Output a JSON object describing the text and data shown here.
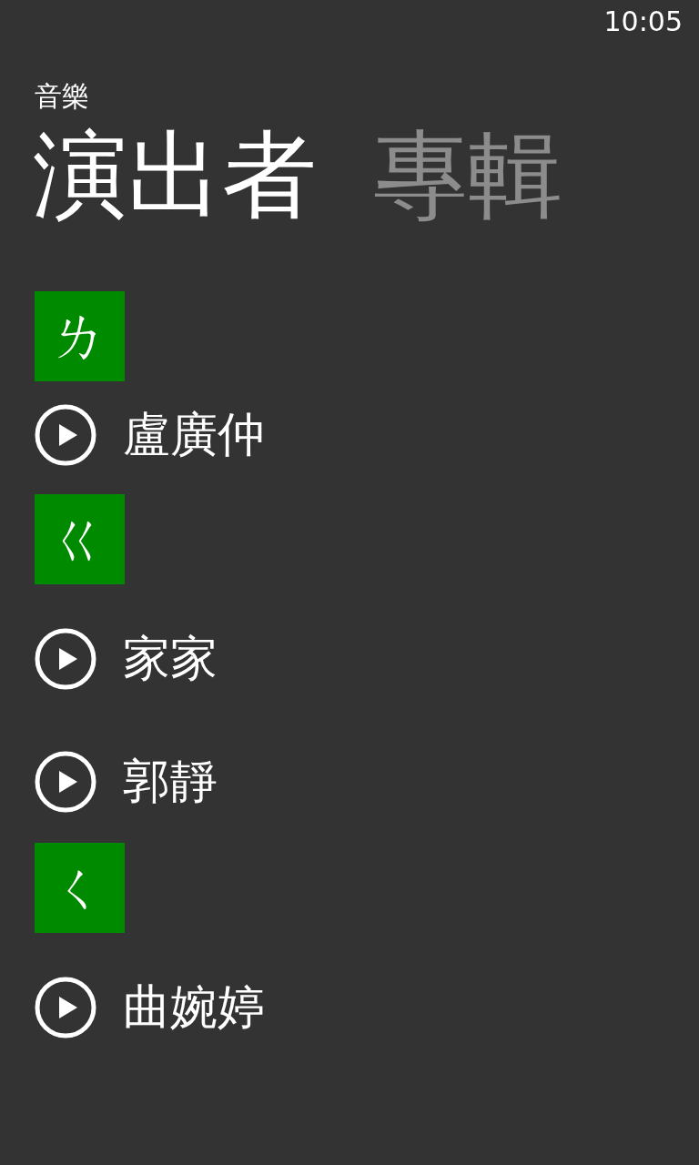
{
  "status_bar": {
    "time": "10:05"
  },
  "app_title": "音樂",
  "pivot": [
    {
      "label": "演出者",
      "selected": true
    },
    {
      "label": "專輯",
      "selected": false
    }
  ],
  "groups": [
    {
      "letter": "ㄌ",
      "artists": [
        {
          "name": "盧廣仲"
        }
      ]
    },
    {
      "letter": "ㄍ",
      "artists": [
        {
          "name": "家家"
        },
        {
          "name": "郭靜"
        }
      ]
    },
    {
      "letter": "ㄑ",
      "artists": [
        {
          "name": "曲婉婷"
        }
      ]
    }
  ]
}
